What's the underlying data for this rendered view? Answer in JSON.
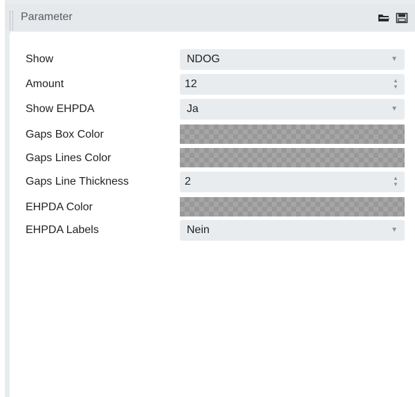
{
  "panel": {
    "title": "Parameter",
    "icons": [
      "open-folder-icon",
      "save-icon"
    ]
  },
  "params": [
    {
      "label": "Show",
      "type": "select",
      "value": "NDOG"
    },
    {
      "label": "Amount",
      "type": "number",
      "value": "12"
    },
    {
      "label": "Show EHPDA",
      "type": "select",
      "value": "Ja"
    },
    {
      "label": "Gaps Box Color",
      "type": "color",
      "value": "transparent"
    },
    {
      "label": "Gaps Lines Color",
      "type": "color",
      "value": "transparent"
    },
    {
      "label": "Gaps Line Thickness",
      "type": "number",
      "value": "2"
    },
    {
      "label": "EHPDA Color",
      "type": "color",
      "value": "transparent"
    },
    {
      "label": "EHPDA Labels",
      "type": "select",
      "value": "Nein"
    }
  ]
}
